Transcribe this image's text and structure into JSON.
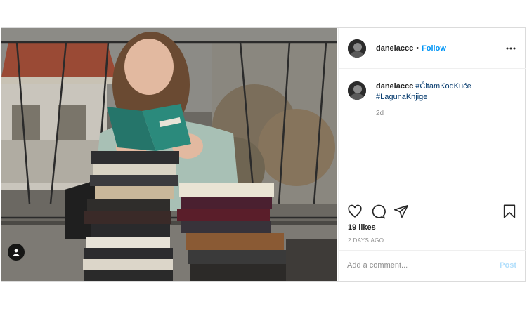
{
  "post": {
    "username": "danelaccc",
    "separator": "•",
    "follow_label": "Follow",
    "caption": {
      "username": "danelaccc",
      "hashtags": [
        "#ČitamKodKuće",
        "#LagunaKnjige"
      ],
      "time_ago": "2d"
    },
    "likes": "19 likes",
    "date": "2 DAYS AGO",
    "comment": {
      "placeholder": "Add a comment...",
      "post_label": "Post"
    },
    "icons": {
      "more": "more-horizontal-icon",
      "like": "heart-icon",
      "comment": "comment-icon",
      "share": "share-paper-plane-icon",
      "save": "bookmark-icon",
      "user_tag": "user-tag-icon"
    },
    "colors": {
      "accent": "#0095f6",
      "hashtag": "#00376b",
      "muted": "#8e8e8e",
      "post_disabled": "#b2dffc"
    }
  }
}
